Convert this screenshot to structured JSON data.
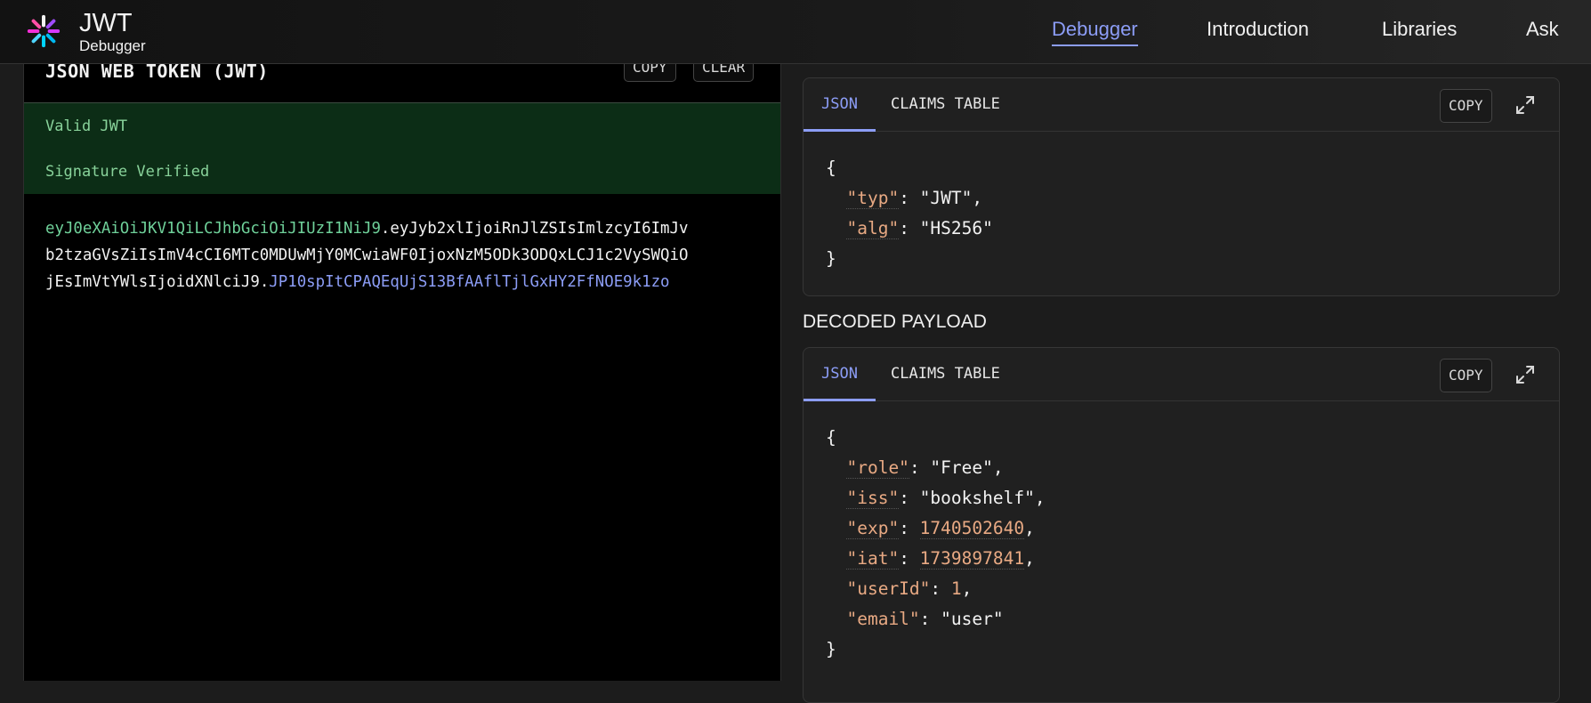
{
  "brand": {
    "title": "JWT",
    "subtitle": "Debugger"
  },
  "nav": {
    "debugger": "Debugger",
    "introduction": "Introduction",
    "libraries": "Libraries",
    "ask": "Ask"
  },
  "encoded": {
    "title": "JSON WEB TOKEN (JWT)",
    "copy_label": "COPY",
    "clear_label": "CLEAR",
    "status_valid": "Valid JWT",
    "status_signature": "Signature Verified",
    "token_header": "eyJ0eXAiOiJKV1QiLCJhbGciOiJIUzI1NiJ9",
    "token_payload_line1": "eyJyb2xlIjoiRnJlZSIsImlzcyI6ImJv",
    "token_payload_line2": "b2tzaGVsZiIsImV4cCI6MTc0MDUwMjY0MCwiaWF0IjoxNzM5ODk3ODQxLCJ1c2VySWQiO",
    "token_payload_line3": "jEsImVtYWlsIjoidXNlciJ9",
    "token_signature": "JP10spItCPAQEqUjS13BfAAflTjlGxHY2FfNOE9k1zo",
    "dot": "."
  },
  "header_panel": {
    "tab_json": "JSON",
    "tab_claims": "CLAIMS TABLE",
    "copy_label": "COPY",
    "json": {
      "open": "{",
      "close": "}",
      "typ_key": "\"typ\"",
      "typ_value": "\"JWT\"",
      "alg_key": "\"alg\"",
      "alg_value": "\"HS256\""
    }
  },
  "payload_panel": {
    "section_label": "DECODED PAYLOAD",
    "tab_json": "JSON",
    "tab_claims": "CLAIMS TABLE",
    "copy_label": "COPY",
    "json": {
      "open": "{",
      "close": "}",
      "role_key": "\"role\"",
      "role_value": "\"Free\"",
      "iss_key": "\"iss\"",
      "iss_value": "\"bookshelf\"",
      "exp_key": "\"exp\"",
      "exp_value": "1740502640",
      "iat_key": "\"iat\"",
      "iat_value": "1739897841",
      "userId_key": "\"userId\"",
      "userId_value": "1",
      "email_key": "\"email\"",
      "email_value": "\"user\""
    }
  },
  "colors": {
    "accent": "#8c9df6",
    "token_header": "#6fd19a",
    "json_key": "#e8a983",
    "valid_bg": "#0c2d16"
  },
  "icons": {
    "logo": "jwt-logo-icon",
    "expand": "expand-icon"
  }
}
